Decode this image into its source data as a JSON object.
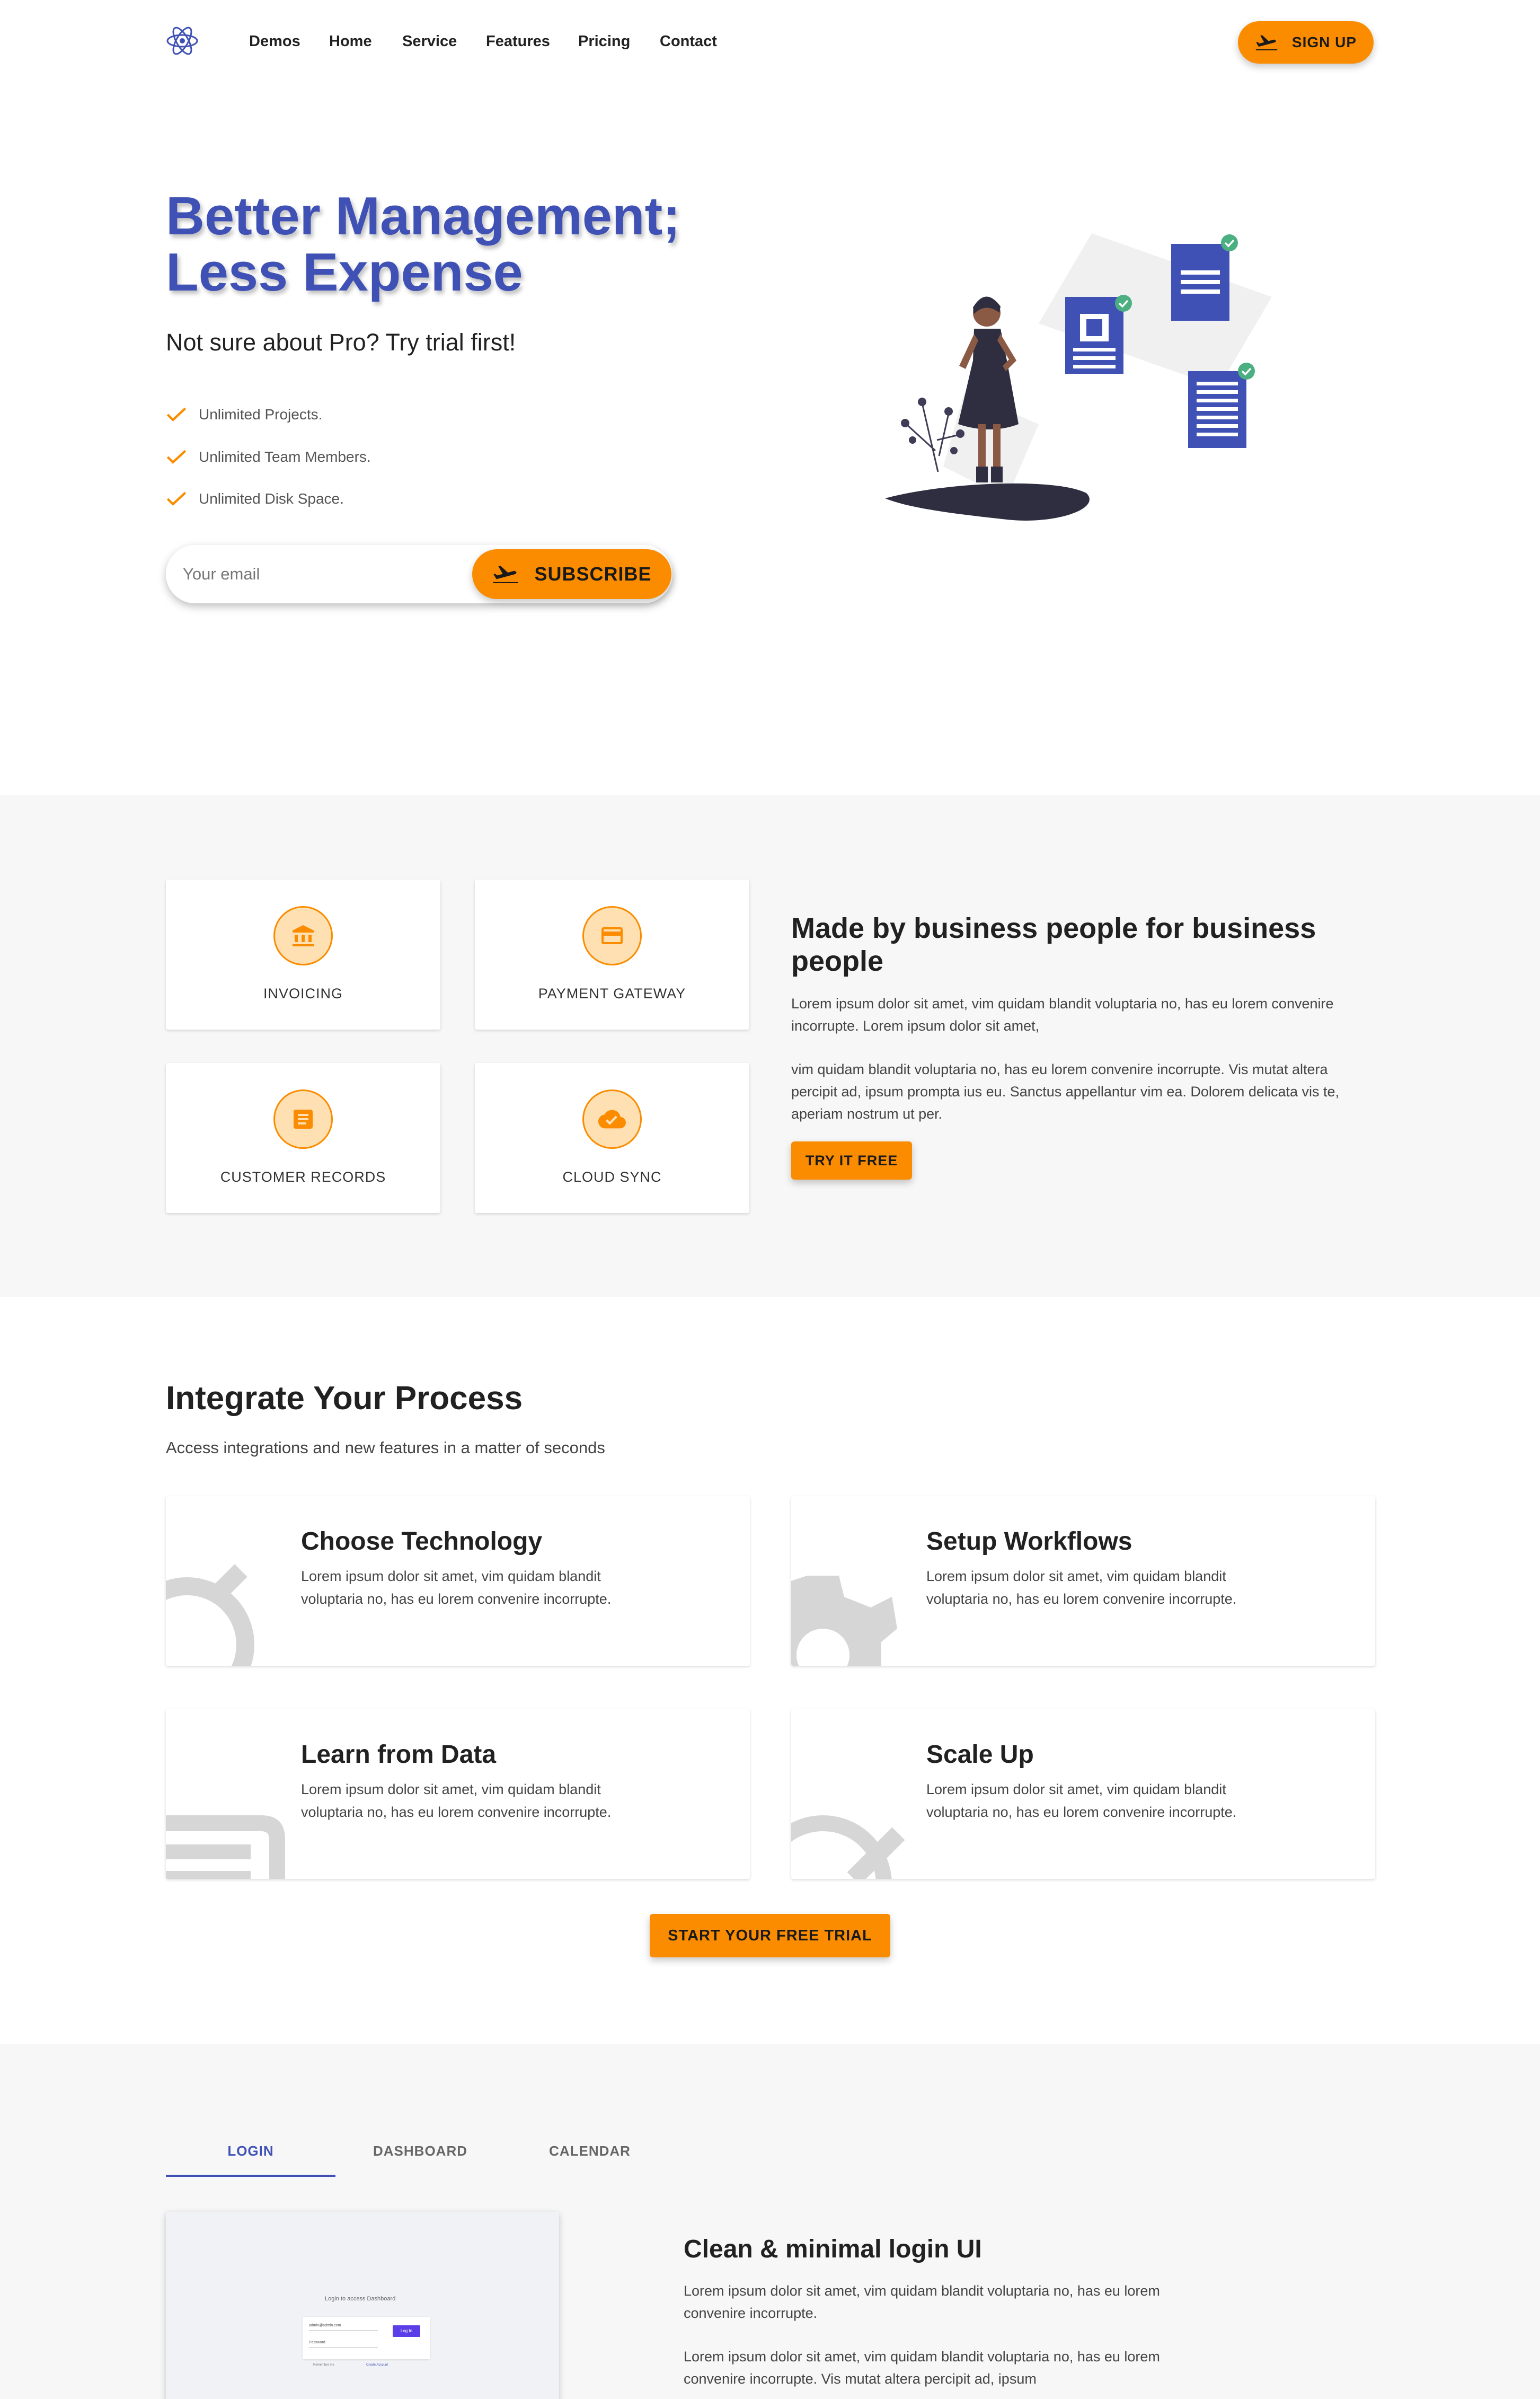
{
  "nav": {
    "links": [
      "Demos",
      "Home",
      "Service",
      "Features",
      "Pricing",
      "Contact"
    ],
    "signup_label": "SIGN UP"
  },
  "hero": {
    "title_line1": "Better Management;",
    "title_line2": "Less Expense",
    "subtitle": "Not sure about Pro? Try trial first!",
    "checks": [
      "Unlimited Projects.",
      "Unlimited Team Members.",
      "Unlimited Disk Space."
    ],
    "email_placeholder": "Your email",
    "subscribe_label": "SUBSCRIBE"
  },
  "features": {
    "cards": [
      {
        "label": "INVOICING",
        "icon": "bank-icon"
      },
      {
        "label": "PAYMENT GATEWAY",
        "icon": "credit-card-icon"
      },
      {
        "label": "CUSTOMER RECORDS",
        "icon": "document-icon"
      },
      {
        "label": "CLOUD SYNC",
        "icon": "cloud-done-icon"
      }
    ],
    "heading": "Made by business people for business people",
    "para1": "Lorem ipsum dolor sit amet, vim quidam blandit voluptaria no, has eu lorem convenire incorrupte. Lorem ipsum dolor sit amet,",
    "para2": "vim quidam blandit voluptaria no, has eu lorem convenire incorrupte. Vis mutat altera percipit ad, ipsum prompta ius eu. Sanctus appellantur vim ea. Dolorem delicata vis te, aperiam nostrum ut per.",
    "cta_label": "TRY IT FREE"
  },
  "integrate": {
    "heading": "Integrate Your Process",
    "subheading": "Access integrations and new features in a matter of seconds",
    "cards": [
      {
        "title": "Choose Technology",
        "text": "Lorem ipsum dolor sit amet, vim quidam blandit voluptaria no, has eu lorem convenire incorrupte.",
        "icon": "timer-icon"
      },
      {
        "title": "Setup Workflows",
        "text": "Lorem ipsum dolor sit amet, vim quidam blandit voluptaria no, has eu lorem convenire incorrupte.",
        "icon": "gear-icon"
      },
      {
        "title": "Learn from Data",
        "text": "Lorem ipsum dolor sit amet, vim quidam blandit voluptaria no, has eu lorem convenire incorrupte.",
        "icon": "report-icon"
      },
      {
        "title": "Scale Up",
        "text": "Lorem ipsum dolor sit amet, vim quidam blandit voluptaria no, has eu lorem convenire incorrupte.",
        "icon": "tools-icon"
      }
    ],
    "cta_label": "START YOUR FREE TRIAL"
  },
  "showcase": {
    "tabs": [
      "LOGIN",
      "DASHBOARD",
      "CALENDAR"
    ],
    "active_tab": "LOGIN",
    "heading": "Clean & minimal login UI",
    "para1": "Lorem ipsum dolor sit amet, vim quidam blandit voluptaria no, has eu lorem convenire incorrupte.",
    "para2": "Lorem ipsum dolor sit amet, vim quidam blandit voluptaria no, has eu lorem convenire incorrupte. Vis mutat altera percipit ad, ipsum",
    "mock_title": "Login to access Dashboard",
    "mock_email": "admin@admin.com",
    "mock_password": "Password",
    "mock_button": "Log In",
    "mock_remember": "Remember me",
    "mock_link": "Create Account"
  },
  "colors": {
    "accent": "#fb8c00",
    "primary": "#3f51b5",
    "section_gray": "#f7f7f7"
  }
}
